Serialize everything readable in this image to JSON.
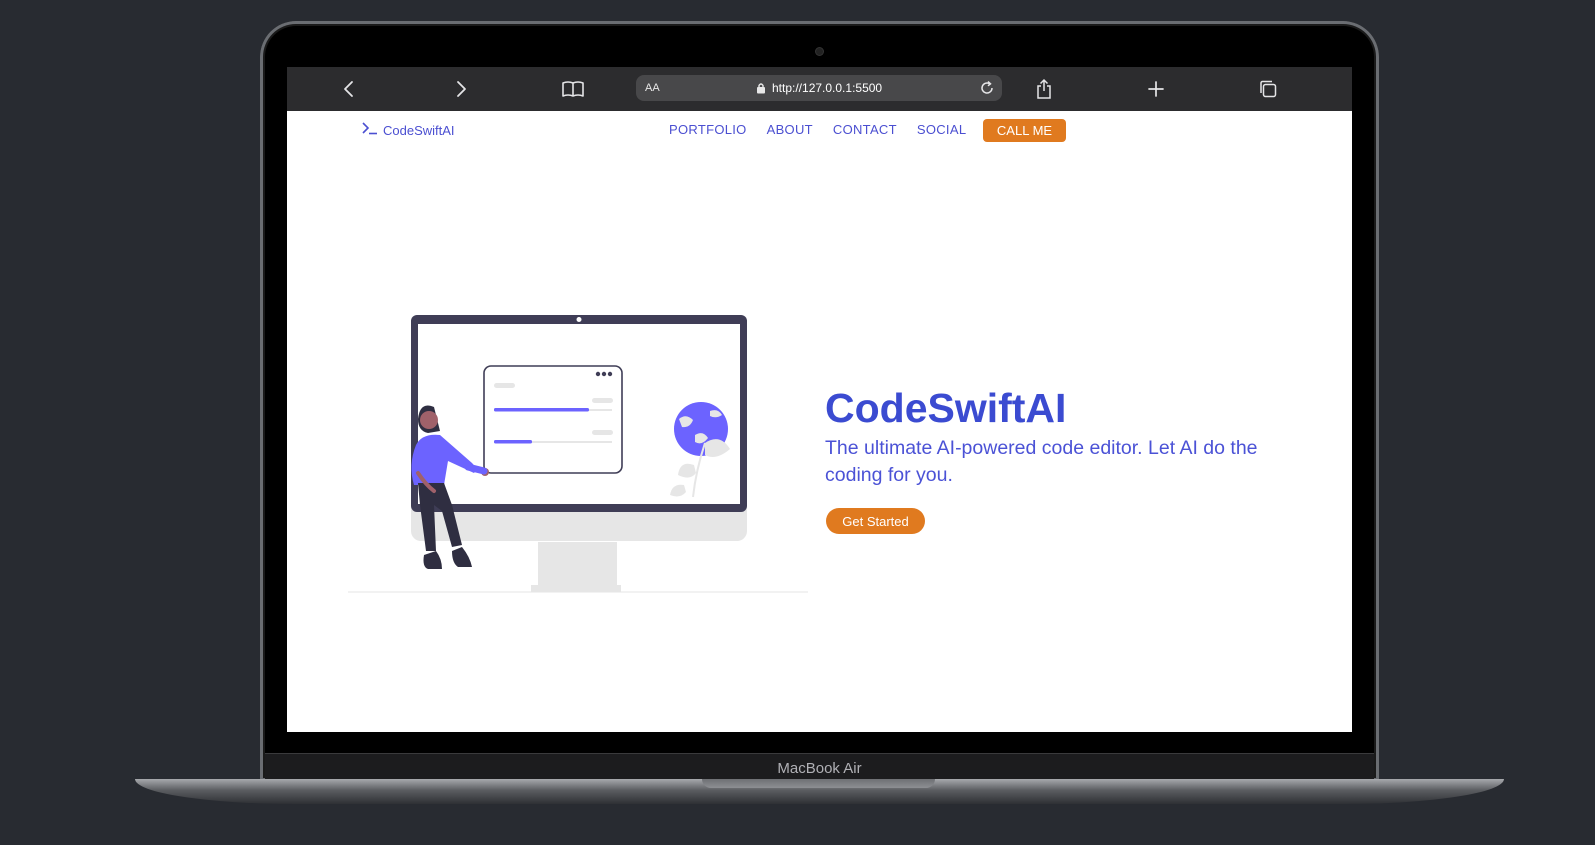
{
  "browser": {
    "text_size_label": "AA",
    "url": "http://127.0.0.1:5500"
  },
  "site": {
    "logo_text": "CodeSwiftAI",
    "nav": [
      "PORTFOLIO",
      "ABOUT",
      "CONTACT",
      "SOCIAL"
    ],
    "cta_label": "CALL ME"
  },
  "hero": {
    "title": "CodeSwiftAI",
    "subtitle": "The ultimate AI-powered code editor. Let AI do the coding for you.",
    "button_label": "Get Started"
  },
  "device": {
    "label": "MacBook Air"
  },
  "colors": {
    "brand_blue": "#4b4fd1",
    "accent_orange": "#e07a1f",
    "illustration_purple": "#6c63ff",
    "background": "#282b31"
  },
  "icons": [
    "back-icon",
    "forward-icon",
    "book-icon",
    "lock-icon",
    "reload-icon",
    "share-icon",
    "plus-icon",
    "tabs-icon",
    "terminal-icon"
  ]
}
